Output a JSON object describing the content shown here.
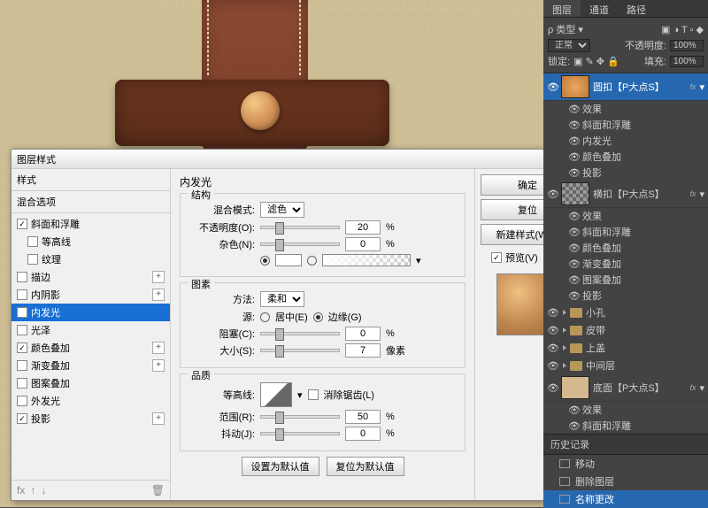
{
  "canvas": {
    "bg": "#d4c49b"
  },
  "dialog": {
    "title": "图层样式",
    "styles_header": "样式",
    "blend_options": "混合选项",
    "items": [
      {
        "label": "斜面和浮雕",
        "checked": true,
        "plus": false
      },
      {
        "label": "等高线",
        "checked": false,
        "sub": true
      },
      {
        "label": "纹理",
        "checked": false,
        "sub": true
      },
      {
        "label": "描边",
        "checked": false,
        "plus": true
      },
      {
        "label": "内阴影",
        "checked": false,
        "plus": true
      },
      {
        "label": "内发光",
        "checked": true,
        "selected": true
      },
      {
        "label": "光泽",
        "checked": false
      },
      {
        "label": "颜色叠加",
        "checked": true,
        "plus": true
      },
      {
        "label": "渐变叠加",
        "checked": false,
        "plus": true
      },
      {
        "label": "图案叠加",
        "checked": false
      },
      {
        "label": "外发光",
        "checked": false
      },
      {
        "label": "投影",
        "checked": true,
        "plus": true
      }
    ],
    "section": "内发光",
    "g_struct": "结构",
    "blend_mode_label": "混合模式:",
    "blend_mode_value": "滤色",
    "opacity_label": "不透明度(O):",
    "opacity_value": "20",
    "noise_label": "杂色(N):",
    "noise_value": "0",
    "pct": "%",
    "g_elem": "图素",
    "method_label": "方法:",
    "method_value": "柔和",
    "source_label": "源:",
    "source_center": "居中(E)",
    "source_edge": "边缘(G)",
    "choke_label": "阻塞(C):",
    "choke_value": "0",
    "size_label": "大小(S):",
    "size_value": "7",
    "px": "像素",
    "g_qual": "品质",
    "contour_label": "等高线:",
    "antialias_label": "消除锯齿(L)",
    "range_label": "范围(R):",
    "range_value": "50",
    "jitter_label": "抖动(J):",
    "jitter_value": "0",
    "btn_default": "设置为默认值",
    "btn_reset_default": "复位为默认值",
    "btn_ok": "确定",
    "btn_cancel": "复位",
    "btn_newstyle": "新建样式(W)...",
    "preview_label": "预览(V)"
  },
  "panels": {
    "tabs": [
      "图层",
      "通道",
      "路径"
    ],
    "type_label": "类型",
    "blend": "正常",
    "opacity_label": "不透明度:",
    "opacity_val": "100%",
    "lock_label": "锁定:",
    "fill_label": "填充:",
    "fill_val": "100%",
    "effects": "效果",
    "fx_bevel": "斜面和浮雕",
    "fx_innerglow": "内发光",
    "fx_color": "颜色叠加",
    "fx_grad": "渐变叠加",
    "fx_pattern": "图案叠加",
    "fx_shadow": "投影",
    "layer1": "圆扣【P大点S】",
    "layer2": "横扣【P大点S】",
    "folder1": "小孔",
    "folder2": "皮带",
    "folder3": "上盖",
    "folder4": "中间层",
    "layer3": "底面【P大点S】",
    "fx": "fx",
    "history_tab": "历史记录",
    "hist1": "移动",
    "hist2": "删除图层",
    "hist3": "名称更改"
  }
}
